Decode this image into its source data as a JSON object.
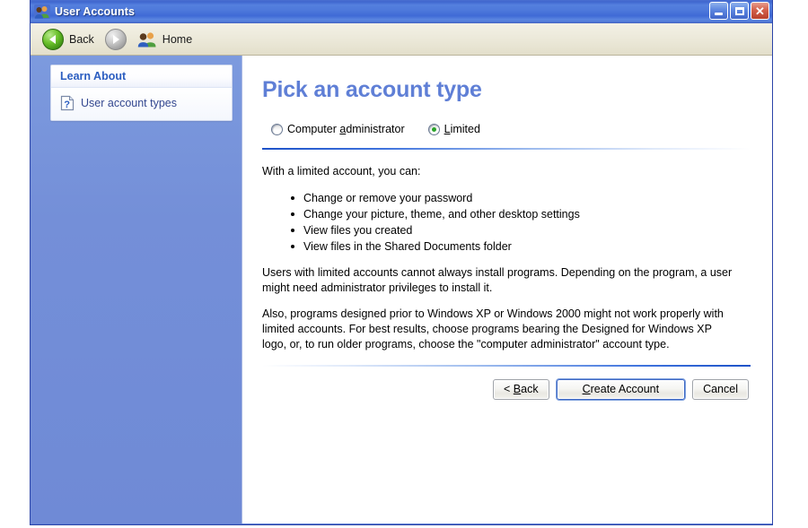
{
  "window": {
    "title": "User Accounts",
    "title_icon": "users-icon",
    "controls": {
      "minimize": "Minimize",
      "maximize": "Maximize",
      "close": "Close"
    }
  },
  "toolbar": {
    "back_label": "Back",
    "back_icon": "back-arrow-icon",
    "forward_icon": "forward-arrow-icon",
    "home_label": "Home",
    "home_icon": "users-icon"
  },
  "sidebar": {
    "panel_title": "Learn About",
    "links": [
      {
        "label": "User account types",
        "icon": "help-document-icon"
      }
    ]
  },
  "content": {
    "page_title": "Pick an account type",
    "options": [
      {
        "label_before": "Computer ",
        "accel": "a",
        "label_after": "dministrator",
        "checked": false
      },
      {
        "label_before": "",
        "accel": "L",
        "label_after": "imited",
        "checked": true
      }
    ],
    "intro": "With a limited account, you can:",
    "bullets": [
      "Change or remove your password",
      "Change your picture, theme, and other desktop settings",
      "View files you created",
      "View files in the Shared Documents folder"
    ],
    "paragraph1": "Users with limited accounts cannot always install programs. Depending on the program, a user might need administrator privileges to install it.",
    "paragraph2": "Also, programs designed prior to Windows XP or Windows 2000 might not work properly with limited accounts. For best results, choose programs bearing the Designed for Windows XP logo, or, to run older programs, choose the \"computer administrator\" account type.",
    "buttons": [
      {
        "prefix": "< ",
        "accel": "B",
        "suffix": "ack",
        "default": false
      },
      {
        "prefix": "",
        "accel": "C",
        "suffix": "reate Account",
        "default": true
      },
      {
        "prefix": "Cancel",
        "accel": "",
        "suffix": "",
        "default": false
      }
    ]
  },
  "colors": {
    "title_bar_blue": "#4e79db",
    "sidebar_blue": "#7c9ade",
    "heading_blue": "#5f7fd6",
    "toolbar_cream": "#ebe8d8",
    "radio_green": "#2aa32a",
    "link_blue": "#33478f"
  }
}
